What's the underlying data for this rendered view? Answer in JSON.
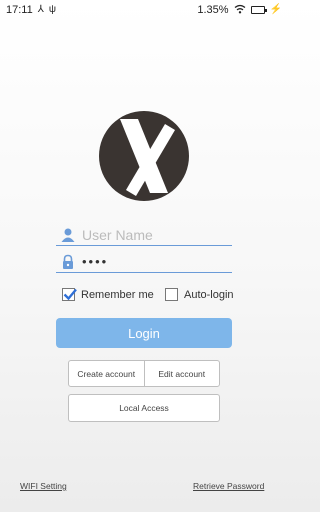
{
  "status_bar": {
    "time": "17:11",
    "battery_percent": "1.35%"
  },
  "login": {
    "username_placeholder": "User Name",
    "password_value": "••••",
    "remember_label": "Remember me",
    "remember_checked": true,
    "autologin_label": "Auto-login",
    "autologin_checked": false,
    "login_label": "Login"
  },
  "actions": {
    "create_account": "Create account",
    "edit_account": "Edit account",
    "local_access": "Local Access"
  },
  "footer": {
    "wifi_setting": "WIFI Setting",
    "retrieve_password": "Retrieve Password"
  },
  "colors": {
    "accent": "#7eb6ea",
    "underline": "#6a9bd8",
    "logo": "#3a3431",
    "check": "#2f6fd6"
  },
  "icons": [
    "notification-icon",
    "usb-icon",
    "wifi-icon",
    "battery-icon",
    "charging-icon",
    "user-icon",
    "lock-icon",
    "logo-x"
  ]
}
